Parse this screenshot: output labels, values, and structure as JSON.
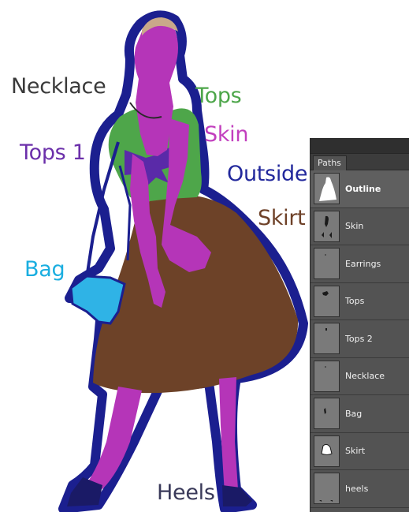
{
  "labels": {
    "necklace": {
      "text": "Necklace",
      "color": "#3a3a3a"
    },
    "tops": {
      "text": "Tops",
      "color": "#4da64a"
    },
    "skin": {
      "text": "Skin",
      "color": "#c23fbe"
    },
    "tops1": {
      "text": "Tops 1",
      "color": "#6b2faa"
    },
    "outside": {
      "text": "Outside",
      "color": "#22289c"
    },
    "skirt": {
      "text": "Skirt",
      "color": "#6e4128"
    },
    "bag": {
      "text": "Bag",
      "color": "#1aaee0"
    },
    "heels": {
      "text": "Heels",
      "color": "#3a3a5a"
    }
  },
  "colors": {
    "outline": "#1b1f8f",
    "skin": "#b535b8",
    "top": "#4ea64a",
    "bow": "#5a2aa8",
    "skirt": "#6d4228",
    "bag": "#2fb3e6",
    "heels": "#1a1a66",
    "hair": "#c9a98a"
  },
  "panel": {
    "tab": "Paths",
    "items": [
      {
        "label": "Outline",
        "icon": "outline-thumb-icon",
        "active": true
      },
      {
        "label": "Skin",
        "icon": "skin-thumb-icon",
        "active": false
      },
      {
        "label": "Earrings",
        "icon": "earrings-thumb-icon",
        "active": false
      },
      {
        "label": "Tops",
        "icon": "tops-thumb-icon",
        "active": false
      },
      {
        "label": "Tops 2",
        "icon": "tops2-thumb-icon",
        "active": false
      },
      {
        "label": "Necklace",
        "icon": "necklace-thumb-icon",
        "active": false
      },
      {
        "label": "Bag",
        "icon": "bag-thumb-icon",
        "active": false
      },
      {
        "label": "Skirt",
        "icon": "skirt-thumb-icon",
        "active": false
      },
      {
        "label": "heels",
        "icon": "heels-thumb-icon",
        "active": false
      }
    ]
  }
}
